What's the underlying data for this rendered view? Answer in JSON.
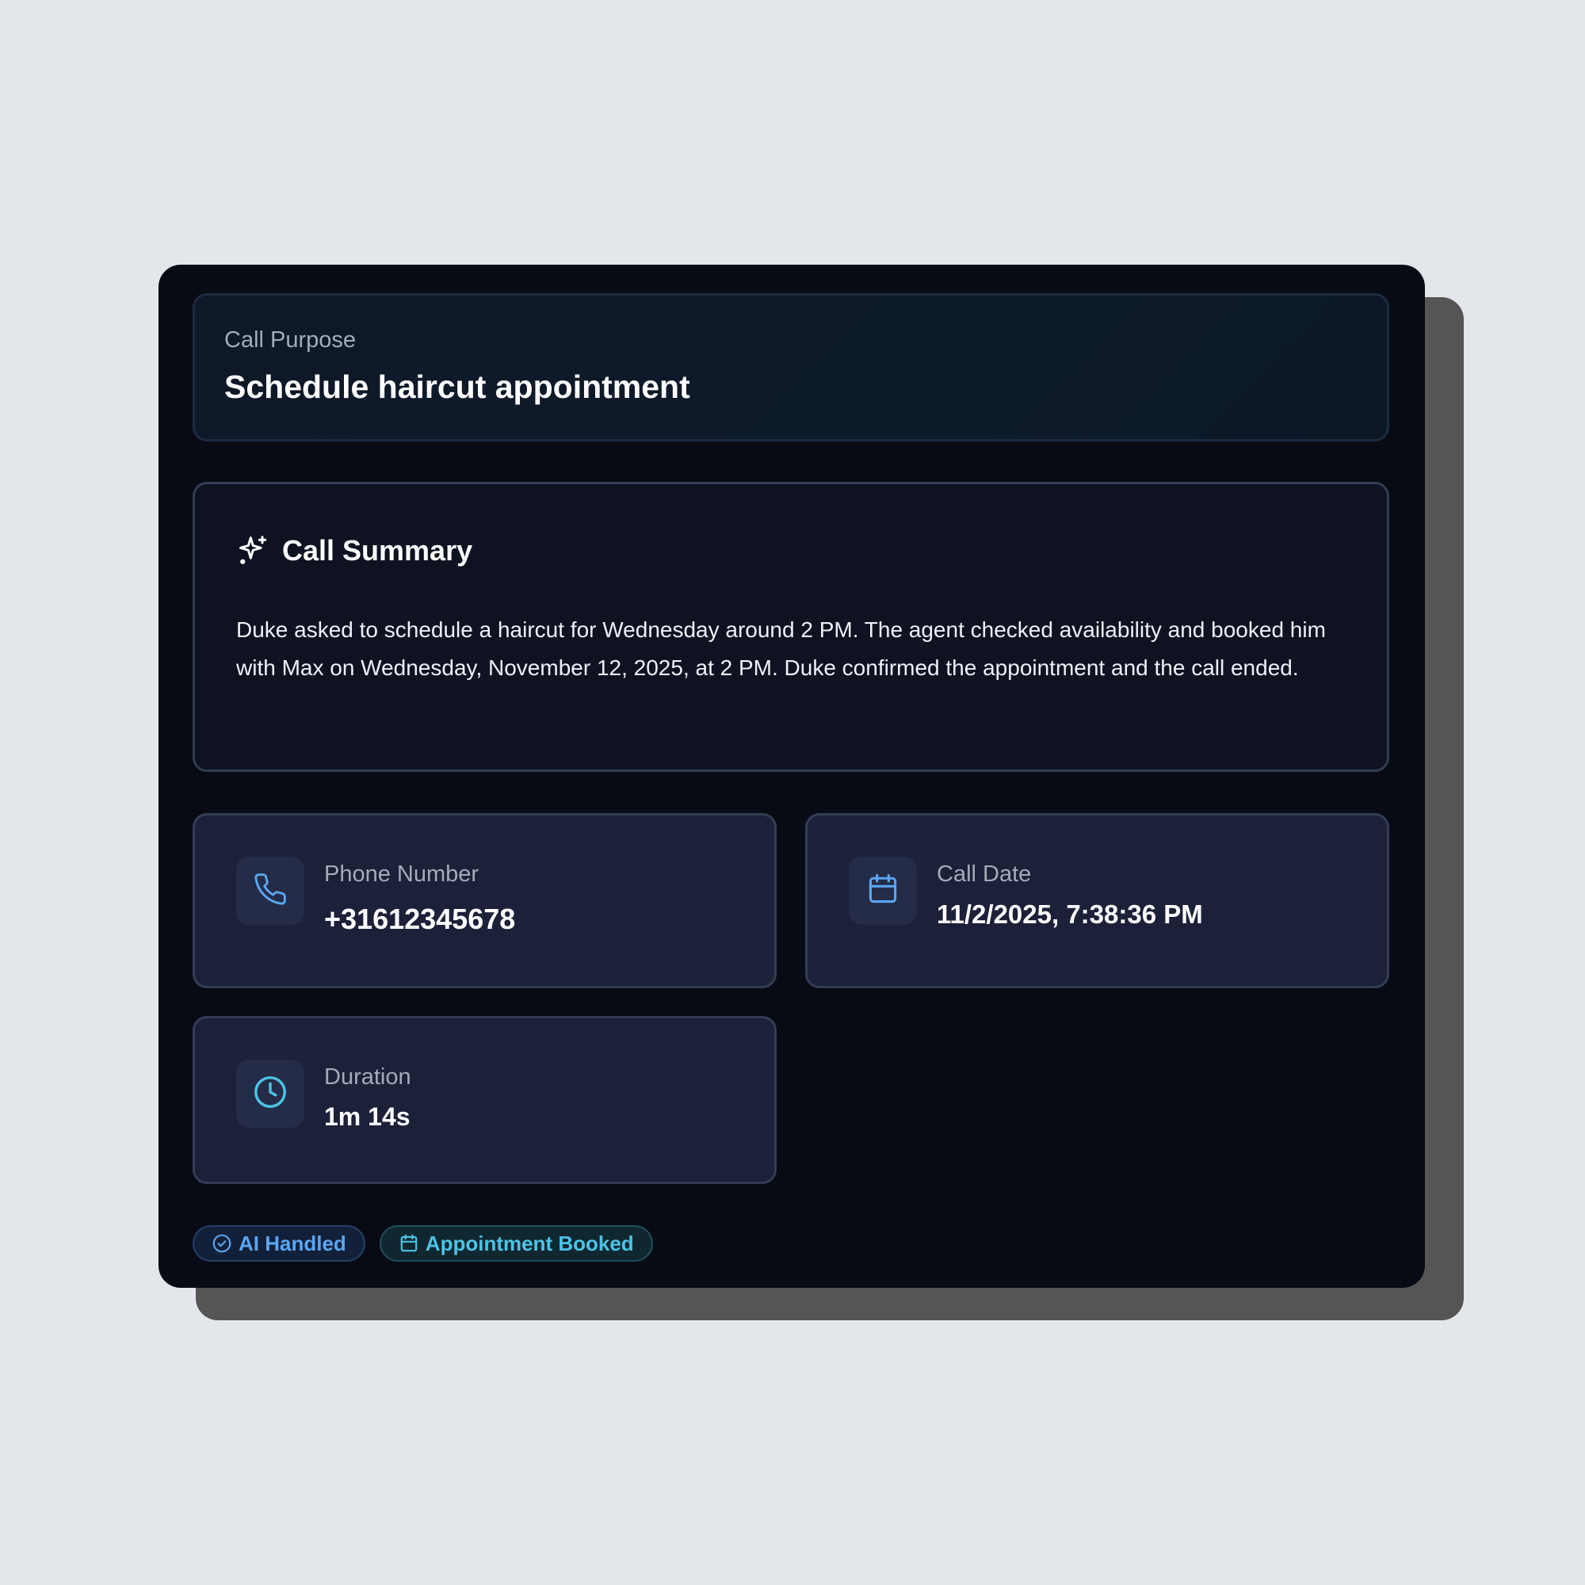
{
  "purpose": {
    "label": "Call Purpose",
    "title": "Schedule haircut appointment"
  },
  "summary": {
    "title": "Call Summary",
    "icon": "sparkles-icon",
    "text": "Duke asked to schedule a haircut for Wednesday around 2 PM. The agent checked availability and booked him with Max on Wednesday, November 12, 2025, at 2 PM. Duke confirmed the appointment and the call ended."
  },
  "details": {
    "phone": {
      "icon": "phone-icon",
      "label": "Phone Number",
      "value": "+31612345678"
    },
    "date": {
      "icon": "calendar-icon",
      "label": "Call Date",
      "value": "11/2/2025, 7:38:36 PM"
    },
    "duration": {
      "icon": "clock-icon",
      "label": "Duration",
      "value": "1m 14s"
    }
  },
  "badges": [
    {
      "icon": "check-circle-icon",
      "label": "AI Handled"
    },
    {
      "icon": "calendar-icon",
      "label": "Appointment Booked"
    }
  ],
  "colors": {
    "card_bg": "#090b14",
    "accent_blue": "#5aa6f3",
    "accent_cyan": "#4cc3e8",
    "page_bg": "#e3e7ec"
  }
}
